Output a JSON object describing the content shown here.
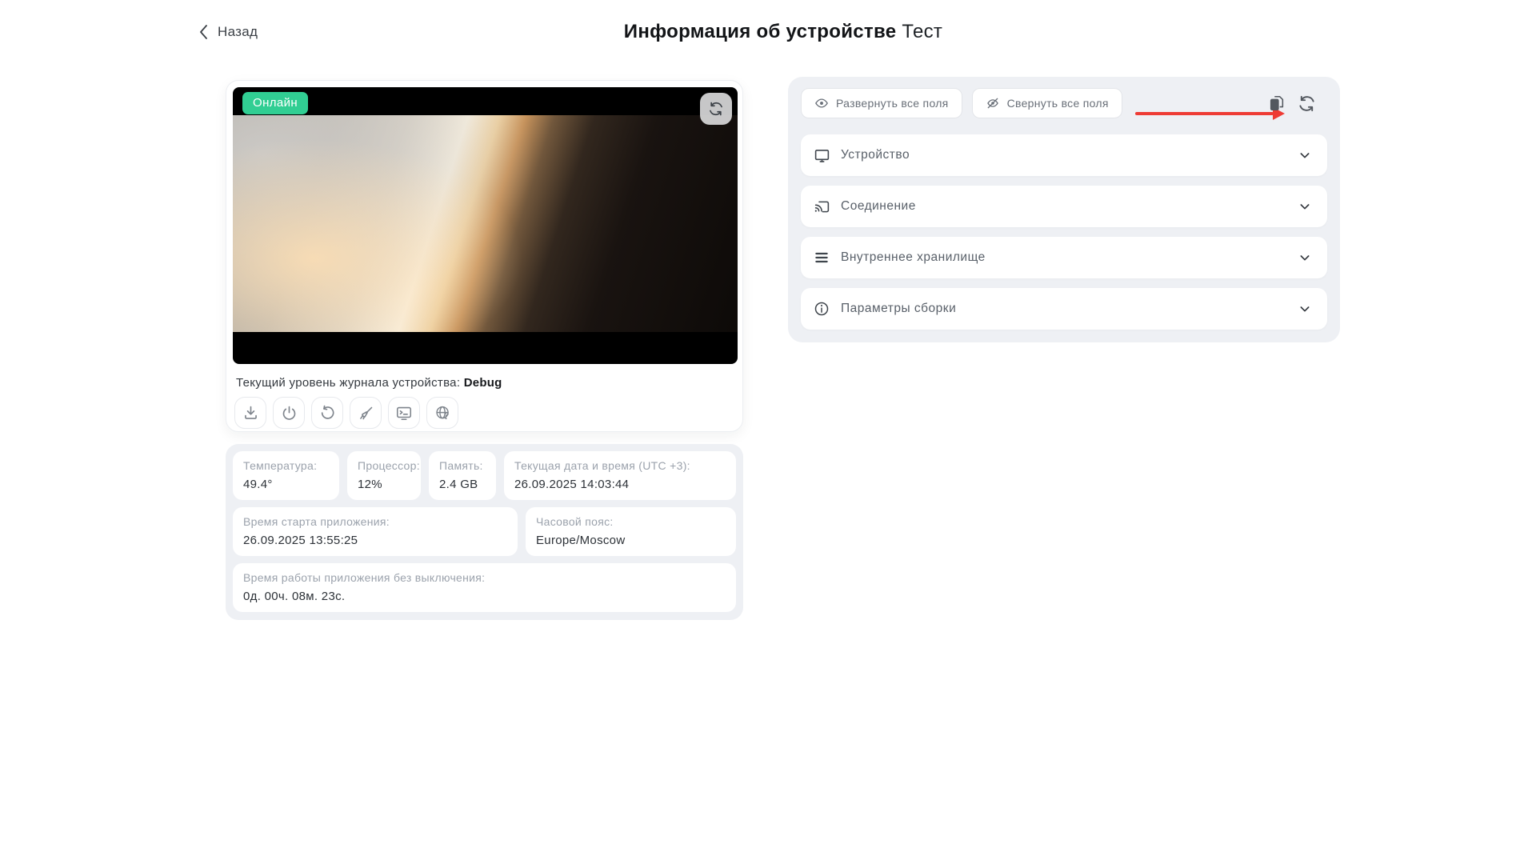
{
  "header": {
    "back_label": "Назад",
    "title": "Информация об устройстве",
    "device_name": "Тест"
  },
  "device_preview": {
    "status_badge": "Онлайн",
    "overlay_icon": "refresh-icon"
  },
  "log_level": {
    "label": "Текущий уровень журнала устройства:",
    "value": "Debug"
  },
  "device_actions": {
    "icons": [
      "download",
      "power",
      "restart",
      "clean",
      "terminal",
      "network-check"
    ]
  },
  "stats": {
    "temperature": {
      "label": "Температура:",
      "value": "49.4°"
    },
    "cpu": {
      "label": "Процессор:",
      "value": "12%"
    },
    "memory": {
      "label": "Память:",
      "value": "2.4 GB"
    },
    "datetime": {
      "label": "Текущая дата и время (UTC +3):",
      "value": "26.09.2025 14:03:44"
    },
    "app_start": {
      "label": "Время старта приложения:",
      "value": "26.09.2025 13:55:25"
    },
    "timezone": {
      "label": "Часовой пояс:",
      "value": "Europe/Moscow"
    },
    "uptime": {
      "label": "Время работы приложения без выключения:",
      "value": "0д. 00ч. 08м. 23с."
    }
  },
  "info_panel": {
    "expand_all_label": "Развернуть все поля",
    "collapse_all_label": "Свернуть все поля",
    "copy_icon": "copy-icon",
    "refresh_icon": "refresh-icon",
    "sections": [
      {
        "label": "Устройство",
        "icon": "monitor"
      },
      {
        "label": "Соединение",
        "icon": "cast"
      },
      {
        "label": "Внутреннее хранилище",
        "icon": "storage"
      },
      {
        "label": "Параметры сборки",
        "icon": "info"
      }
    ]
  },
  "annotation": {
    "shape": "arrow",
    "color": "#ee3b34"
  },
  "colors": {
    "accent_green": "#31ce93",
    "panel_bg": "#eef0f4",
    "arrow_red": "#ee3b34"
  }
}
